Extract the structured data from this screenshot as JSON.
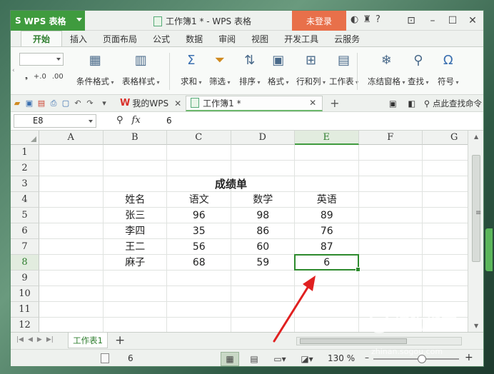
{
  "app": {
    "name": "WPS 表格",
    "document_title": "工作簿1 * - WPS 表格",
    "login_label": "未登录",
    "help_label": "?"
  },
  "ribbon_tabs": [
    "开始",
    "插入",
    "页面布局",
    "公式",
    "数据",
    "审阅",
    "视图",
    "开发工具",
    "云服务"
  ],
  "active_tab": "开始",
  "ribbon_buttons": [
    {
      "label": "条件格式",
      "icon": "conditional-format-icon"
    },
    {
      "label": "表格样式",
      "icon": "table-style-icon"
    },
    {
      "label": "求和",
      "icon": "sum-icon"
    },
    {
      "label": "筛选",
      "icon": "filter-icon"
    },
    {
      "label": "排序",
      "icon": "sort-icon"
    },
    {
      "label": "格式",
      "icon": "format-icon"
    },
    {
      "label": "行和列",
      "icon": "rows-cols-icon"
    },
    {
      "label": "工作表",
      "icon": "worksheet-icon"
    },
    {
      "label": "冻结窗格",
      "icon": "freeze-panes-icon"
    },
    {
      "label": "查找",
      "icon": "find-icon"
    },
    {
      "label": "符号",
      "icon": "symbol-icon"
    }
  ],
  "doc_tabs": {
    "wps_tab": "我的WPS",
    "workbook_tab": "工作簿1 *",
    "search_command": "点此查找命令"
  },
  "formula_bar": {
    "cell_ref": "E8",
    "fx_label": "fx",
    "value": "6"
  },
  "columns": [
    "A",
    "B",
    "C",
    "D",
    "E",
    "F",
    "G"
  ],
  "rows": [
    "1",
    "2",
    "3",
    "4",
    "5",
    "6",
    "7",
    "8",
    "9",
    "10",
    "11",
    "12"
  ],
  "sheet": {
    "title": "成绩单",
    "headers": [
      "姓名",
      "语文",
      "数学",
      "英语"
    ],
    "records": [
      [
        "张三",
        "96",
        "98",
        "89"
      ],
      [
        "李四",
        "35",
        "86",
        "76"
      ],
      [
        "王二",
        "56",
        "60",
        "87"
      ],
      [
        "麻子",
        "68",
        "59",
        "6"
      ]
    ]
  },
  "sheet_tabs": [
    "工作表1"
  ],
  "status": {
    "value": "6",
    "zoom": "130 %",
    "zoom_minus": "–",
    "zoom_plus": "+"
  },
  "watermark": {
    "brand": "搜狗指南",
    "url": "zhinan.sogou.com"
  },
  "colors": {
    "accent_green": "#3f9b3e",
    "login_orange": "#e8704a",
    "selection_green": "#2d8a2d",
    "annotation_red": "#e02020"
  }
}
